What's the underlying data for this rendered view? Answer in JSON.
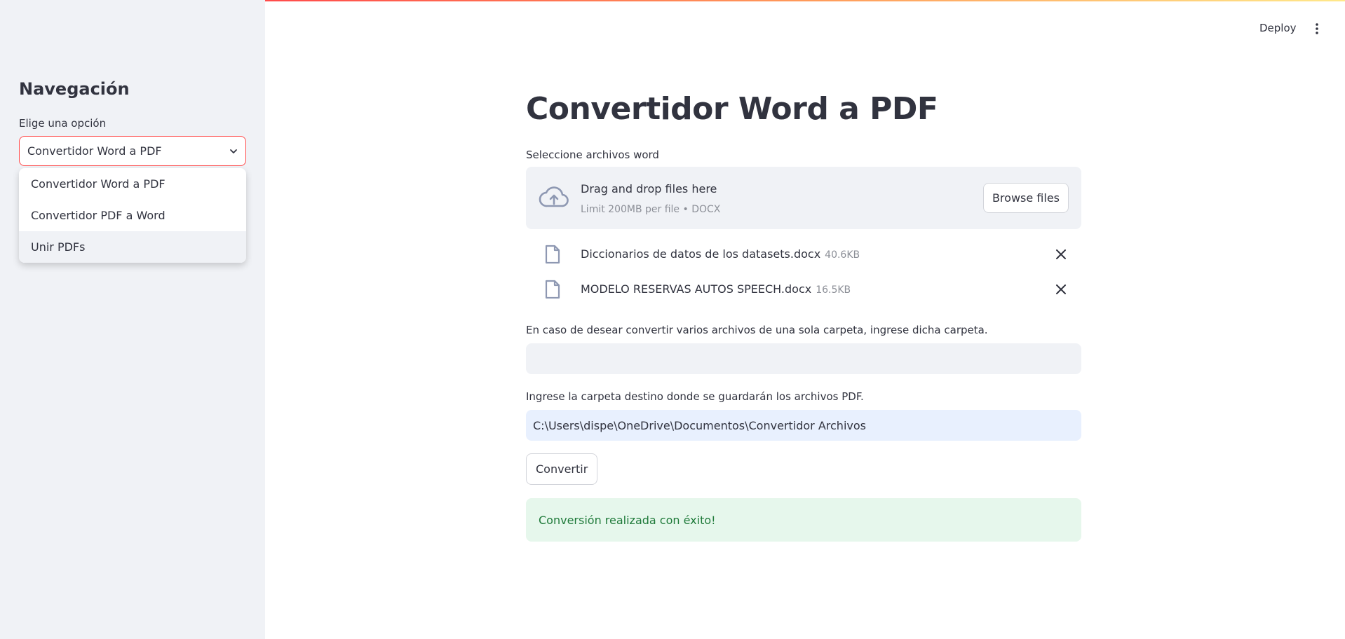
{
  "header": {
    "deploy_label": "Deploy"
  },
  "sidebar": {
    "title": "Navegación",
    "select_label": "Elige una opción",
    "selected_value": "Convertidor Word a PDF",
    "options": [
      "Convertidor Word a PDF",
      "Convertidor PDF a Word",
      "Unir PDFs"
    ]
  },
  "main": {
    "title": "Convertidor Word a PDF",
    "uploader_label": "Seleccione archivos word",
    "dropzone_text": "Drag and drop files here",
    "dropzone_limit": "Limit 200MB per file • DOCX",
    "browse_label": "Browse files",
    "files": [
      {
        "name": "Diccionarios de datos de los datasets.docx",
        "size": "40.6KB"
      },
      {
        "name": "MODELO RESERVAS AUTOS SPEECH.docx",
        "size": "16.5KB"
      }
    ],
    "folder_label": "En caso de desear convertir varios archivos de una sola carpeta, ingrese dicha carpeta.",
    "folder_value": "",
    "dest_label": "Ingrese la carpeta destino donde se guardarán los archivos PDF.",
    "dest_value": "C:\\Users\\dispe\\OneDrive\\Documentos\\Convertidor Archivos",
    "convert_label": "Convertir",
    "success_message": "Conversión realizada con éxito!"
  },
  "colors": {
    "accent": "#ff4b4b",
    "sidebar_bg": "#f0f2f6",
    "success_bg": "#e6f7ec",
    "success_text": "#1f7a3a"
  },
  "icons": [
    "chevron-down-icon",
    "kebab-menu-icon",
    "cloud-upload-icon",
    "file-icon",
    "close-icon"
  ]
}
